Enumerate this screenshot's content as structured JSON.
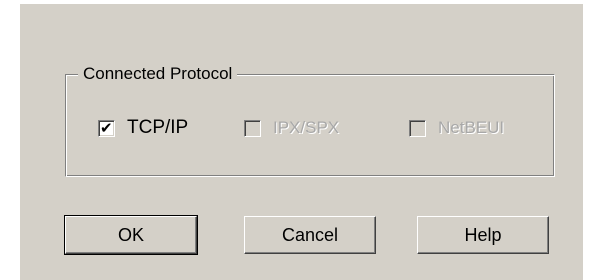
{
  "group": {
    "legend": "Connected Protocol"
  },
  "protocols": [
    {
      "label": "TCP/IP",
      "checked": true,
      "enabled": true
    },
    {
      "label": "IPX/SPX",
      "checked": false,
      "enabled": false
    },
    {
      "label": "NetBEUI",
      "checked": false,
      "enabled": false
    }
  ],
  "buttons": {
    "ok": "OK",
    "cancel": "Cancel",
    "help": "Help"
  },
  "check_glyph": "✔",
  "colors": {
    "dialog_face": "#d4d0c8",
    "disabled_text": "#a8a8a8"
  }
}
